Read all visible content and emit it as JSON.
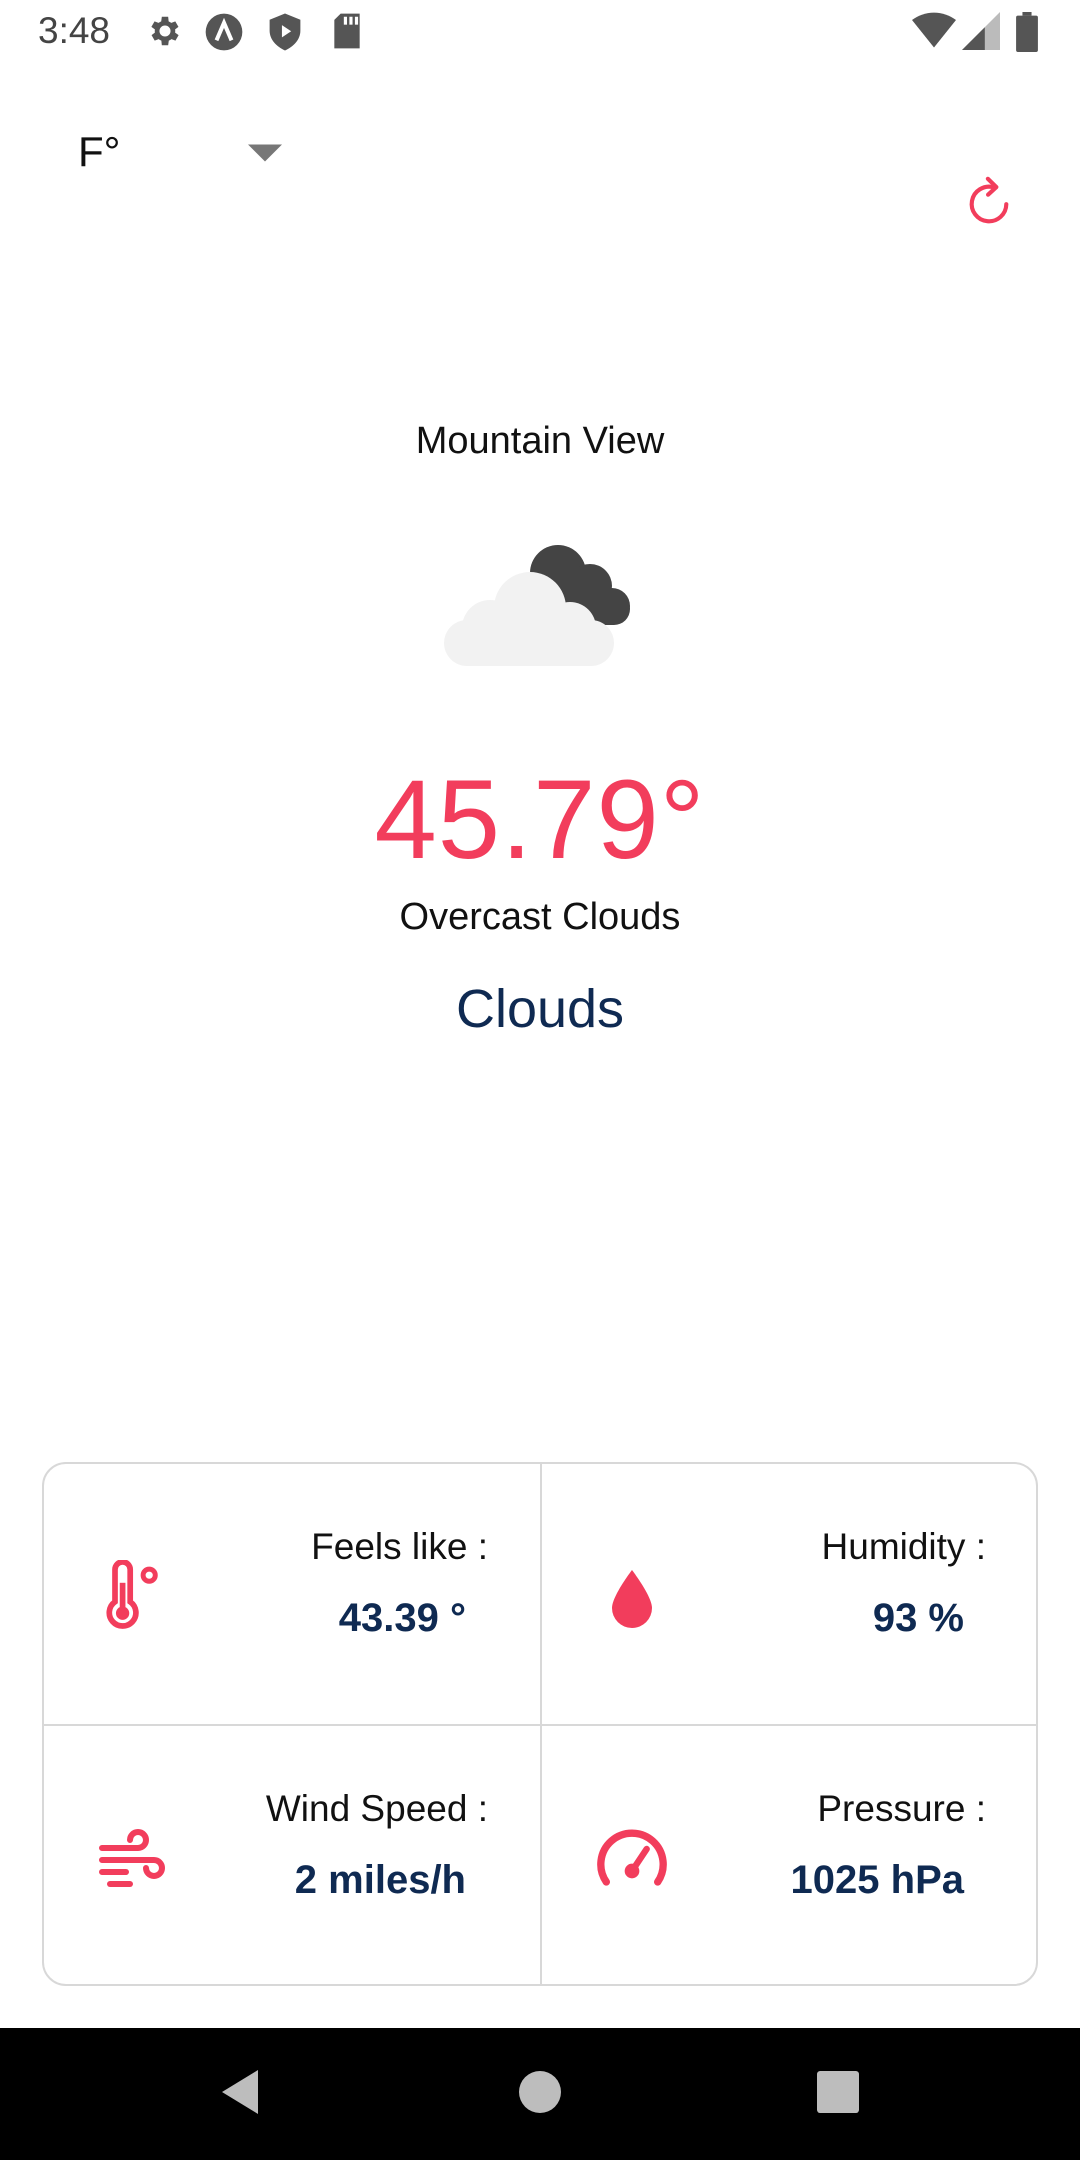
{
  "status_bar": {
    "time": "3:48",
    "left_icons": [
      "gear-icon",
      "a-circle-icon",
      "play-shield-icon",
      "sd-card-icon"
    ],
    "right_icons": [
      "wifi-icon",
      "signal-icon",
      "battery-icon"
    ]
  },
  "unit_select": {
    "selected": "F°",
    "icon": "caret-down-icon"
  },
  "refresh": {
    "icon": "refresh-icon"
  },
  "weather": {
    "city": "Mountain View",
    "icon": "overcast-clouds-icon",
    "temperature": "45.79°",
    "description": "Overcast Clouds",
    "main": "Clouds"
  },
  "details": {
    "feels_like": {
      "label": "Feels like :",
      "value": "43.39 °",
      "icon": "thermometer-icon"
    },
    "humidity": {
      "label": "Humidity :",
      "value": "93 %",
      "icon": "water-drop-icon"
    },
    "wind": {
      "label": "Wind Speed :",
      "value": "2 miles/h",
      "icon": "wind-icon"
    },
    "pressure": {
      "label": "Pressure :",
      "value": "1025 hPa",
      "icon": "gauge-icon"
    }
  },
  "nav_bar": {
    "back": "back-icon",
    "home": "home-icon",
    "recents": "recents-icon"
  },
  "colors": {
    "accent": "#f23d5c",
    "navy": "#0f2a52",
    "border": "#d8d8d8"
  }
}
